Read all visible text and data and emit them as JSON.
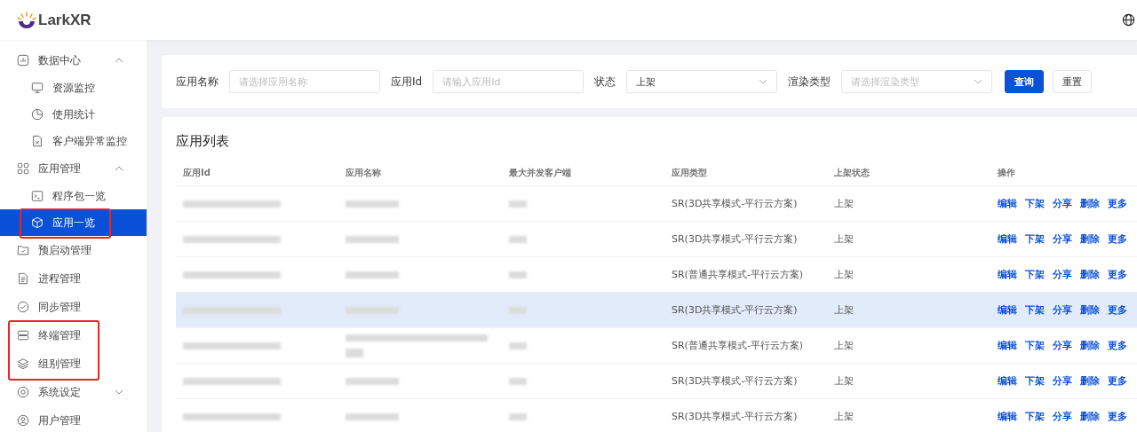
{
  "header": {
    "logo_text": "LarkXR"
  },
  "sidebar": {
    "items": [
      {
        "label": "数据中心",
        "expanded": true,
        "selected": false,
        "highlighted": false,
        "children": [
          {
            "label": "资源监控",
            "selected": false,
            "highlighted": false
          },
          {
            "label": "使用统计",
            "selected": false,
            "highlighted": false
          },
          {
            "label": "客户端异常监控",
            "selected": false,
            "highlighted": false
          }
        ]
      },
      {
        "label": "应用管理",
        "expanded": true,
        "selected": false,
        "highlighted": false,
        "children": [
          {
            "label": "程序包一览",
            "selected": false,
            "highlighted": false
          },
          {
            "label": "应用一览",
            "selected": true,
            "highlighted": true
          }
        ]
      },
      {
        "label": "预启动管理",
        "selected": false,
        "highlighted": false
      },
      {
        "label": "进程管理",
        "selected": false,
        "highlighted": false
      },
      {
        "label": "同步管理",
        "selected": false,
        "highlighted": false
      },
      {
        "label": "终端管理",
        "selected": false,
        "highlighted": true
      },
      {
        "label": "组别管理",
        "selected": false,
        "highlighted": true
      },
      {
        "label": "系统设定",
        "expanded": false,
        "selected": false,
        "highlighted": false
      },
      {
        "label": "用户管理",
        "selected": false,
        "highlighted": false
      }
    ]
  },
  "filters": [
    {
      "kind": "input",
      "label": "应用名称",
      "placeholder": "请选择应用名称"
    },
    {
      "kind": "input",
      "label": "应用Id",
      "placeholder": "请输入应用Id"
    },
    {
      "kind": "select",
      "label": "状态",
      "value": "上架"
    },
    {
      "kind": "select",
      "label": "渲染类型",
      "placeholder": "请选择渲染类型"
    }
  ],
  "filter_buttons": [
    {
      "kind": "primary",
      "label": "查询"
    },
    {
      "kind": "default",
      "label": "重置"
    }
  ],
  "table": {
    "title": "应用列表",
    "columns": [
      "应用Id",
      "应用名称",
      "最大并发客户端",
      "应用类型",
      "上架状态",
      "操作"
    ],
    "rows": [
      {
        "hovered": false,
        "name_wrapped": false,
        "type": "SR(3D共享模式-平行云方案)",
        "status": "上架",
        "actions": [
          "编辑",
          "下架",
          "分享",
          "删除",
          "更多"
        ]
      },
      {
        "hovered": false,
        "name_wrapped": false,
        "type": "SR(3D共享模式-平行云方案)",
        "status": "上架",
        "actions": [
          "编辑",
          "下架",
          "分享",
          "删除",
          "更多"
        ]
      },
      {
        "hovered": false,
        "name_wrapped": false,
        "type": "SR(普通共享模式-平行云方案)",
        "status": "上架",
        "actions": [
          "编辑",
          "下架",
          "分享",
          "删除",
          "更多"
        ]
      },
      {
        "hovered": true,
        "name_wrapped": false,
        "type": "SR(3D共享模式-平行云方案)",
        "status": "上架",
        "actions": [
          "编辑",
          "下架",
          "分享",
          "删除",
          "更多"
        ]
      },
      {
        "hovered": false,
        "name_wrapped": true,
        "type": "SR(普通共享模式-平行云方案)",
        "status": "上架",
        "actions": [
          "编辑",
          "下架",
          "分享",
          "删除",
          "更多"
        ]
      },
      {
        "hovered": false,
        "name_wrapped": false,
        "type": "SR(3D共享模式-平行云方案)",
        "status": "上架",
        "actions": [
          "编辑",
          "下架",
          "分享",
          "删除",
          "更多"
        ]
      },
      {
        "hovered": false,
        "name_wrapped": false,
        "type": "SR(3D共享模式-平行云方案)",
        "status": "上架",
        "actions": [
          "编辑",
          "下架",
          "分享",
          "删除",
          "更多"
        ]
      }
    ]
  }
}
